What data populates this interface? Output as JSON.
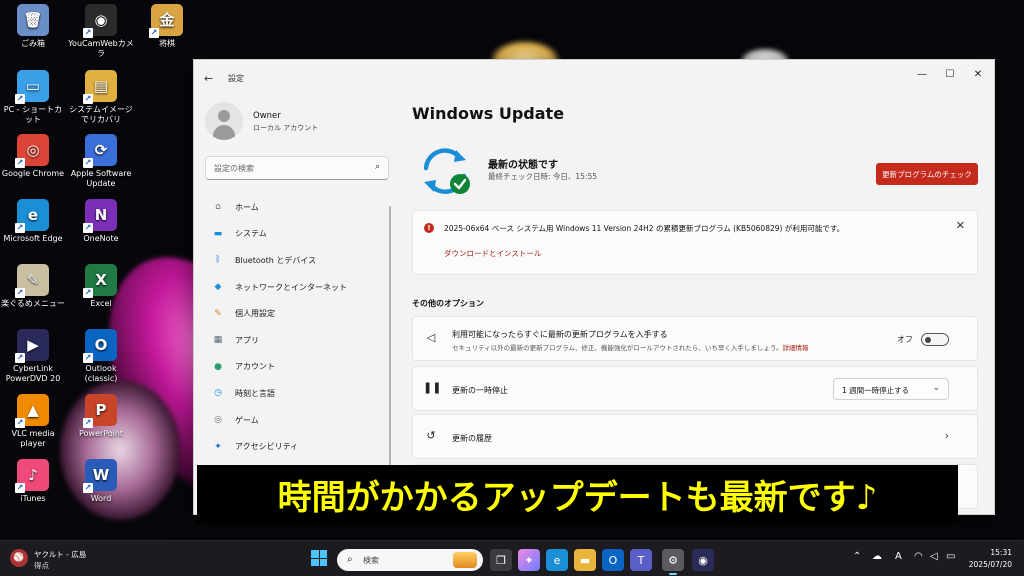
{
  "desktop": {
    "icons": [
      {
        "label": "ごみ箱",
        "glyph": "🗑",
        "color": "#6a8fc7"
      },
      {
        "label": "YouCamWebカメラ",
        "glyph": "◉",
        "color": "#2b2b2b"
      },
      {
        "label": "将棋",
        "glyph": "金",
        "color": "#d9a441"
      },
      {
        "label": "PC - ショートカット",
        "glyph": "▭",
        "color": "#3aa0e8"
      },
      {
        "label": "システムイメージでリカバリ",
        "glyph": "▤",
        "color": "#e0b040"
      },
      {
        "label": "Google Chrome",
        "glyph": "◎",
        "color": "#db4437"
      },
      {
        "label": "Apple Software Update",
        "glyph": "⟳",
        "color": "#3b6fd8"
      },
      {
        "label": "Microsoft Edge",
        "glyph": "e",
        "color": "#1b8fd6"
      },
      {
        "label": "OneNote",
        "glyph": "N",
        "color": "#7b2fb7"
      },
      {
        "label": "楽ぐるめメニュー",
        "glyph": "✎",
        "color": "#c8c0a0"
      },
      {
        "label": "Excel",
        "glyph": "X",
        "color": "#1f7a45"
      },
      {
        "label": "CyberLink PowerDVD 20",
        "glyph": "▶",
        "color": "#2a2a5a"
      },
      {
        "label": "Outlook (classic)",
        "glyph": "O",
        "color": "#0a64c2"
      },
      {
        "label": "VLC media player",
        "glyph": "▲",
        "color": "#f08a00"
      },
      {
        "label": "PowerPoint",
        "glyph": "P",
        "color": "#c8452a"
      },
      {
        "label": "iTunes",
        "glyph": "♪",
        "color": "#f04a7a"
      },
      {
        "label": "Word",
        "glyph": "W",
        "color": "#2a5bb8"
      }
    ]
  },
  "window": {
    "app_title": "設定",
    "back_icon": "←",
    "minimize": "—",
    "maximize": "☐",
    "close": "✕"
  },
  "sidebar": {
    "profile_name": "Owner",
    "profile_sub": "ローカル アカウント",
    "search_placeholder": "設定の検索",
    "items": [
      {
        "label": "ホーム",
        "icon": "⌂",
        "color": "#6b6b6b"
      },
      {
        "label": "システム",
        "icon": "▬",
        "color": "#1a8fd8"
      },
      {
        "label": "Bluetooth とデバイス",
        "icon": "ᛒ",
        "color": "#1a6fd8"
      },
      {
        "label": "ネットワークとインターネット",
        "icon": "◆",
        "color": "#1a8fd8"
      },
      {
        "label": "個人用設定",
        "icon": "✎",
        "color": "#d9822b"
      },
      {
        "label": "アプリ",
        "icon": "▦",
        "color": "#5a6a7a"
      },
      {
        "label": "アカウント",
        "icon": "●",
        "color": "#2aa070"
      },
      {
        "label": "時刻と言語",
        "icon": "◷",
        "color": "#1a8fd8"
      },
      {
        "label": "ゲーム",
        "icon": "◎",
        "color": "#6b6b6b"
      },
      {
        "label": "アクセシビリティ",
        "icon": "✦",
        "color": "#1a6fd8"
      }
    ]
  },
  "main": {
    "title": "Windows Update",
    "status_title": "最新の状態です",
    "status_sub": "最終チェック日時: 今日、15:55",
    "check_button": "更新プログラムのチェック",
    "update_text": "2025-06x64 ベース システム用 Windows 11 Version 24H2 の累積更新プログラム (KB5060829) が利用可能です。",
    "download_link": "ダウンロードとインストール",
    "other_options": "その他のオプション",
    "option_latest_title": "利用可能になったらすぐに最新の更新プログラムを入手する",
    "option_latest_sub": "セキュリティ以外の最新の更新プログラム、修正、機能強化がロールアウトされたら、いち早く入手しましょう。",
    "option_latest_link": "詳細情報",
    "toggle_label": "オフ",
    "pause_title": "更新の一時停止",
    "pause_value": "1 週間一時停止する",
    "history_title": "更新の履歴"
  },
  "caption": "時間がかかるアップデートも最新です♪",
  "taskbar": {
    "weather_line1": "ヤクルト - 広島",
    "weather_line2": "得点",
    "search_placeholder": "検索",
    "time": "15:31",
    "date": "2025/07/20"
  }
}
